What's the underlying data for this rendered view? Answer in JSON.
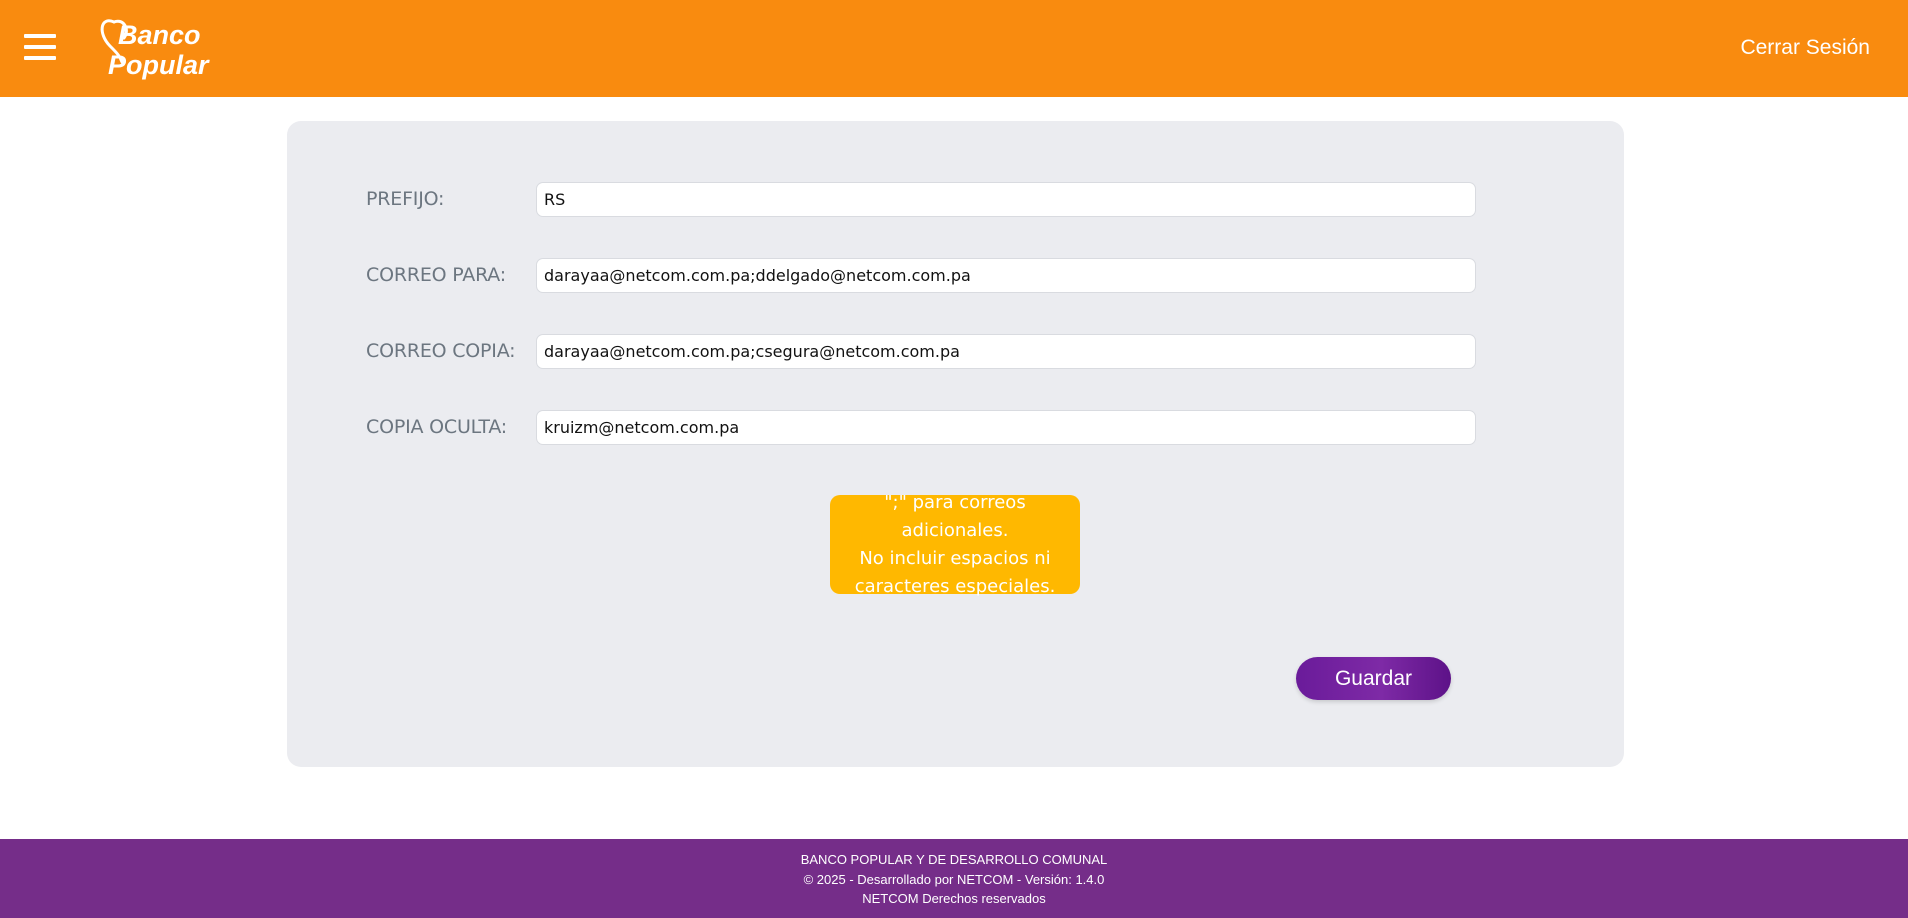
{
  "header": {
    "menu_icon": "hamburger-menu-icon",
    "logo_text_line1": "Banco",
    "logo_text_line2": "Popular",
    "logout_label": "Cerrar Sesión",
    "background_color": "#f98b0f"
  },
  "form": {
    "fields": [
      {
        "label": "PREFIJO:",
        "value": "RS"
      },
      {
        "label": "CORREO PARA:",
        "value": "darayaa@netcom.com.pa;ddelgado@netcom.com.pa"
      },
      {
        "label": "CORREO COPIA:",
        "value": "darayaa@netcom.com.pa;csegura@netcom.com.pa"
      },
      {
        "label": "COPIA OCULTA:",
        "value": "kruizm@netcom.com.pa"
      }
    ],
    "note_lines": [
      "\";\" para correos adicionales.",
      "No incluir espacios ni",
      "caracteres especiales."
    ],
    "save_label": "Guardar"
  },
  "footer": {
    "line1": "BANCO POPULAR Y DE DESARROLLO COMUNAL",
    "line2": "© 2025 - Desarrollado por NETCOM - Versión: 1.4.0",
    "line3": "NETCOM Derechos reservados",
    "background_color": "#752d89"
  },
  "colors": {
    "accent_orange": "#f98b0f",
    "brand_purple": "#6a1b9a",
    "note_yellow": "#ffb800",
    "card_bg": "#ebecf0"
  }
}
